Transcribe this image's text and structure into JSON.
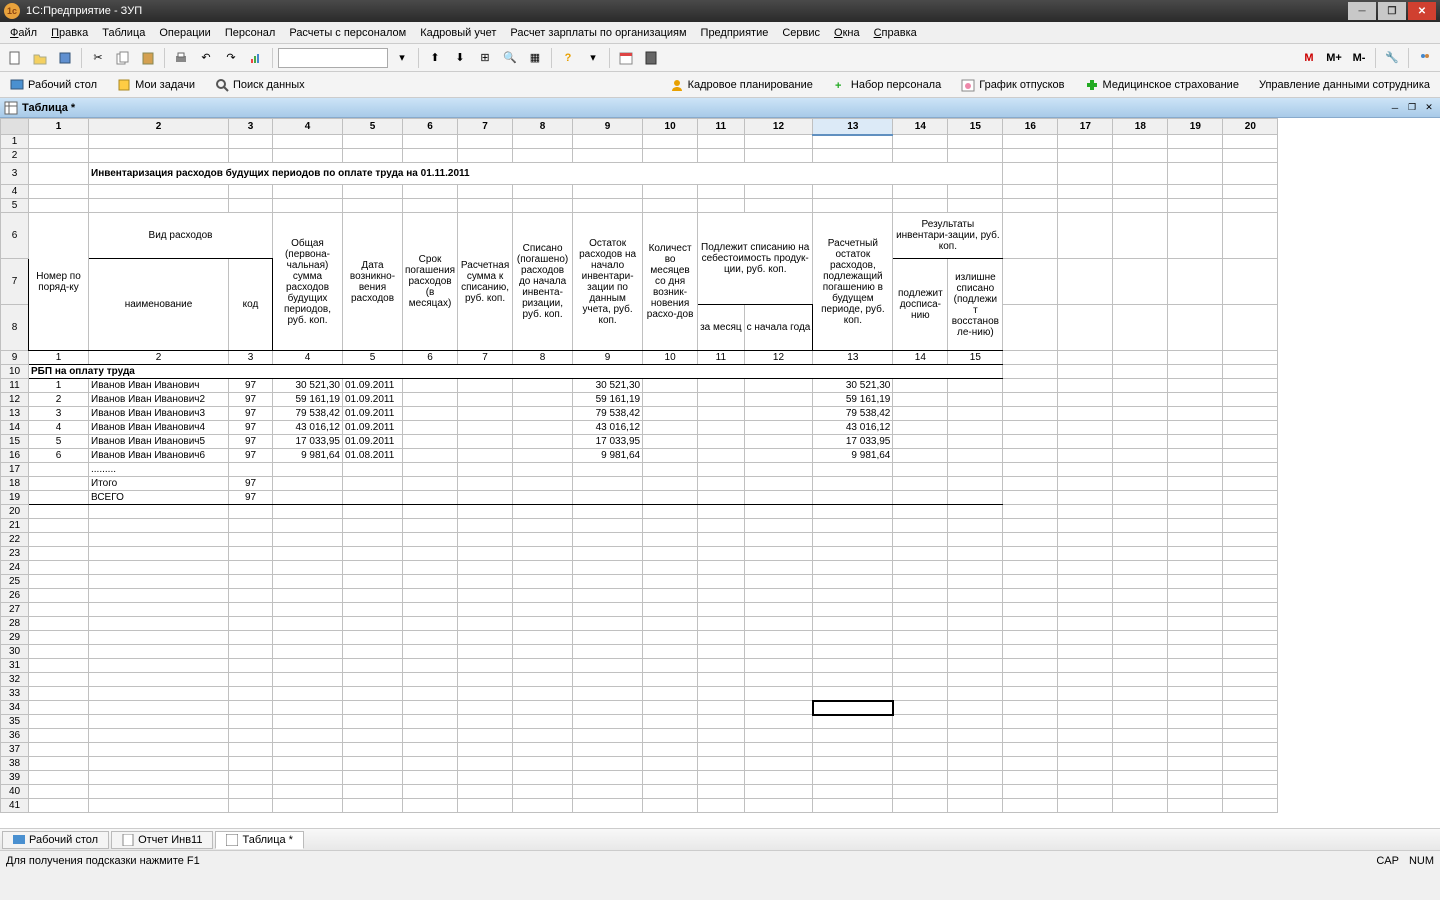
{
  "title": "1С:Предприятие - ЗУП",
  "menus": [
    "Файл",
    "Правка",
    "Таблица",
    "Операции",
    "Персонал",
    "Расчеты с персоналом",
    "Кадровый учет",
    "Расчет зарплаты по организациям",
    "Предприятие",
    "Сервис",
    "Окна",
    "Справка"
  ],
  "menu_underline": [
    "Ф",
    "П",
    "",
    "",
    "",
    "",
    "",
    "",
    "",
    "",
    "О",
    "С"
  ],
  "toolbar2_items": [
    "Рабочий стол",
    "Мои задачи",
    "Поиск данных"
  ],
  "toolbar2_right": [
    "Кадровое планирование",
    "Набор персонала",
    "График отпусков",
    "Медицинское страхование",
    "Управление данными сотрудника"
  ],
  "doc_tab": "Таблица *",
  "col_headers": [
    "1",
    "2",
    "3",
    "4",
    "5",
    "6",
    "7",
    "8",
    "9",
    "10",
    "11",
    "12",
    "13",
    "14",
    "15",
    "16",
    "17",
    "18",
    "19",
    "20"
  ],
  "selected_col": 13,
  "report_title": "Инвентаризация расходов будущих периодов по оплате труда на 01.11.2011",
  "hdr": {
    "vid": "Вид расходов",
    "nomer": "Номер по поряд-ку",
    "naim": "наименование",
    "kod": "код",
    "obsh": "Общая (первона-чальная) сумма расходов будущих периодов, руб. коп.",
    "data_voz": "Дата возникно-вения расходов",
    "srok": "Срок погашения расходов (в месяцах)",
    "rasch_sum": "Расчетная сумма к списанию, руб. коп.",
    "spisano": "Списано (погашено) расходов до начала инвента-ризации, руб. коп.",
    "ostatok": "Остаток расходов на начало инвентари-зации по данным учета, руб. коп.",
    "kolvo": "Количест во месяцев со дня возник-новения расхо-дов",
    "podl": "Подлежит списанию на себестоимость продук-ции, руб. коп.",
    "za_mes": "за месяц",
    "s_nach": "с начала года",
    "rasch_ost": "Расчетный остаток расходов, подлежащий погашению в будущем периоде, руб. коп.",
    "rez": "Результаты инвентари-зации, руб. коп.",
    "podl_dop": "подлежит досписа-нию",
    "izl": "излишне списано (подлежи т восстанов ле-нию)"
  },
  "subrow": [
    "1",
    "2",
    "3",
    "4",
    "5",
    "6",
    "7",
    "8",
    "9",
    "10",
    "11",
    "12",
    "13",
    "14",
    "15"
  ],
  "section": "РБП на оплату труда",
  "rows": [
    {
      "n": "1",
      "name": "Иванов Иван Иванович",
      "kod": "97",
      "sum": "30 521,30",
      "date": "01.09.2011",
      "ost": "30 521,30",
      "r13": "30 521,30"
    },
    {
      "n": "2",
      "name": "Иванов Иван Иванович2",
      "kod": "97",
      "sum": "59 161,19",
      "date": "01.09.2011",
      "ost": "59 161,19",
      "r13": "59 161,19"
    },
    {
      "n": "3",
      "name": "Иванов Иван Иванович3",
      "kod": "97",
      "sum": "79 538,42",
      "date": "01.09.2011",
      "ost": "79 538,42",
      "r13": "79 538,42"
    },
    {
      "n": "4",
      "name": "Иванов Иван Иванович4",
      "kod": "97",
      "sum": "43 016,12",
      "date": "01.09.2011",
      "ost": "43 016,12",
      "r13": "43 016,12"
    },
    {
      "n": "5",
      "name": "Иванов Иван Иванович5",
      "kod": "97",
      "sum": "17 033,95",
      "date": "01.09.2011",
      "ost": "17 033,95",
      "r13": "17 033,95"
    },
    {
      "n": "6",
      "name": "Иванов Иван Иванович6",
      "kod": "97",
      "sum": "9 981,64",
      "date": "01.08.2011",
      "ost": "9 981,64",
      "r13": "9 981,64"
    }
  ],
  "dots": ".........",
  "itogo": "Итого",
  "vsego": "ВСЕГО",
  "itogo_kod": "97",
  "bottom_tabs": [
    "Рабочий стол",
    "Отчет  Инв11",
    "Таблица *"
  ],
  "active_bottom": 2,
  "status": "Для получения подсказки нажмите F1",
  "status_right": [
    "CAP",
    "NUM"
  ],
  "cursor_cell": {
    "row": 34,
    "col": 13
  },
  "chart_data": {
    "type": "table",
    "title": "Инвентаризация расходов будущих периодов по оплате труда на 01.11.2011",
    "columns": [
      "Номер по поряд-ку",
      "наименование",
      "код",
      "Общая сумма руб.коп.",
      "Дата возникновения",
      "Остаток расходов руб.коп.",
      "Расчетный остаток руб.коп."
    ],
    "rows": [
      [
        1,
        "Иванов Иван Иванович",
        97,
        30521.3,
        "01.09.2011",
        30521.3,
        30521.3
      ],
      [
        2,
        "Иванов Иван Иванович2",
        97,
        59161.19,
        "01.09.2011",
        59161.19,
        59161.19
      ],
      [
        3,
        "Иванов Иван Иванович3",
        97,
        79538.42,
        "01.09.2011",
        79538.42,
        79538.42
      ],
      [
        4,
        "Иванов Иван Иванович4",
        97,
        43016.12,
        "01.09.2011",
        43016.12,
        43016.12
      ],
      [
        5,
        "Иванов Иван Иванович5",
        97,
        17033.95,
        "01.09.2011",
        17033.95,
        17033.95
      ],
      [
        6,
        "Иванов Иван Иванович6",
        97,
        9981.64,
        "01.08.2011",
        9981.64,
        9981.64
      ]
    ]
  }
}
